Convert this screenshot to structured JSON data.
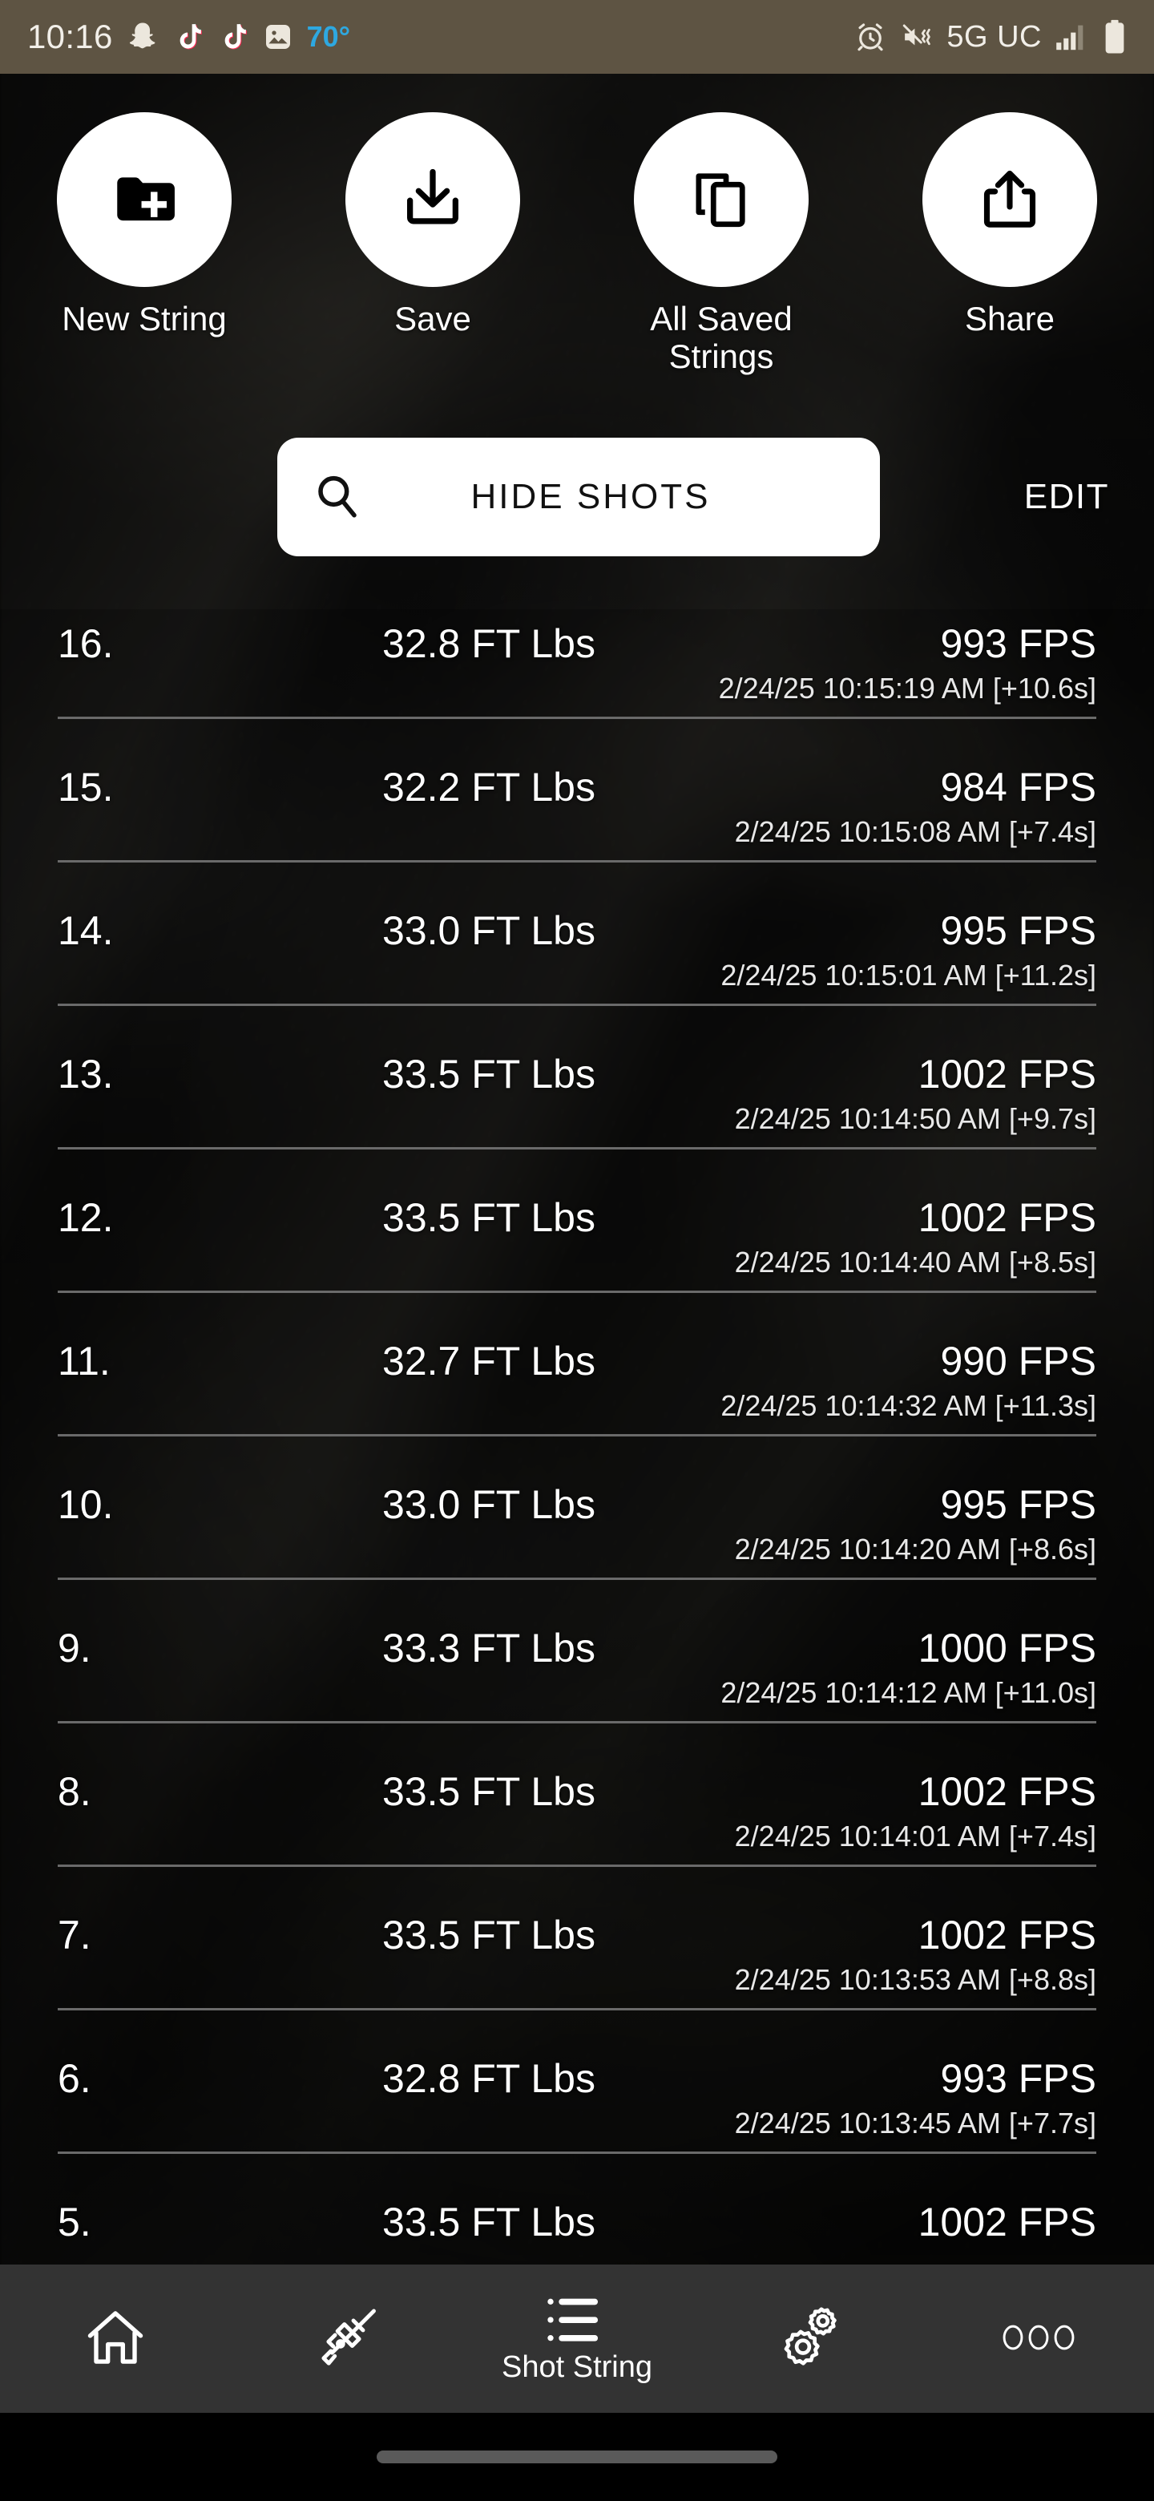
{
  "statusbar": {
    "time": "10:16",
    "temperature": "70°",
    "carrier": "5G UC",
    "icons_left": [
      "snapchat-icon",
      "tiktok-icon",
      "tiktok-icon",
      "gallery-icon"
    ],
    "icons_right": [
      "alarm-icon",
      "vibrate-mute-icon",
      "signal-bars-icon",
      "battery-icon"
    ],
    "background_color": "#5e5443",
    "temp_color": "#2ea8e0"
  },
  "actions": [
    {
      "label": "New String",
      "icon": "folder-plus-icon"
    },
    {
      "label": "Save",
      "icon": "download-tray-icon"
    },
    {
      "label": "All Saved Strings",
      "icon": "copy-icon"
    },
    {
      "label": "Share",
      "icon": "share-upload-icon"
    }
  ],
  "search": {
    "label": "HIDE SHOTS",
    "icon": "search-icon",
    "edit_label": "EDIT"
  },
  "shots": [
    {
      "index": "16.",
      "energy": "32.8 FT Lbs",
      "speed": "993 FPS",
      "timestamp": "2/24/25 10:15:19 AM [+10.6s]"
    },
    {
      "index": "15.",
      "energy": "32.2 FT Lbs",
      "speed": "984 FPS",
      "timestamp": "2/24/25 10:15:08 AM [+7.4s]"
    },
    {
      "index": "14.",
      "energy": "33.0 FT Lbs",
      "speed": "995 FPS",
      "timestamp": "2/24/25 10:15:01 AM [+11.2s]"
    },
    {
      "index": "13.",
      "energy": "33.5 FT Lbs",
      "speed": "1002 FPS",
      "timestamp": "2/24/25 10:14:50 AM [+9.7s]"
    },
    {
      "index": "12.",
      "energy": "33.5 FT Lbs",
      "speed": "1002 FPS",
      "timestamp": "2/24/25 10:14:40 AM [+8.5s]"
    },
    {
      "index": "11.",
      "energy": "32.7 FT Lbs",
      "speed": "990 FPS",
      "timestamp": "2/24/25 10:14:32 AM [+11.3s]"
    },
    {
      "index": "10.",
      "energy": "33.0 FT Lbs",
      "speed": "995 FPS",
      "timestamp": "2/24/25 10:14:20 AM [+8.6s]"
    },
    {
      "index": "9.",
      "energy": "33.3 FT Lbs",
      "speed": "1000 FPS",
      "timestamp": "2/24/25 10:14:12 AM [+11.0s]"
    },
    {
      "index": "8.",
      "energy": "33.5 FT Lbs",
      "speed": "1002 FPS",
      "timestamp": "2/24/25 10:14:01 AM [+7.4s]"
    },
    {
      "index": "7.",
      "energy": "33.5 FT Lbs",
      "speed": "1002 FPS",
      "timestamp": "2/24/25 10:13:53 AM [+8.8s]"
    },
    {
      "index": "6.",
      "energy": "32.8 FT Lbs",
      "speed": "993 FPS",
      "timestamp": "2/24/25 10:13:45 AM [+7.7s]"
    },
    {
      "index": "5.",
      "energy": "33.5 FT Lbs",
      "speed": "1002 FPS",
      "timestamp": ""
    }
  ],
  "bottomnav": {
    "background_color": "#333333",
    "items": [
      {
        "icon": "home-icon",
        "label": "",
        "active": false
      },
      {
        "icon": "rifle-icon",
        "label": "",
        "active": false
      },
      {
        "icon": "list-icon",
        "label": "Shot String",
        "active": true
      },
      {
        "icon": "gears-icon",
        "label": "",
        "active": false
      },
      {
        "icon": "more-dots-icon",
        "label": "",
        "active": false
      }
    ]
  }
}
